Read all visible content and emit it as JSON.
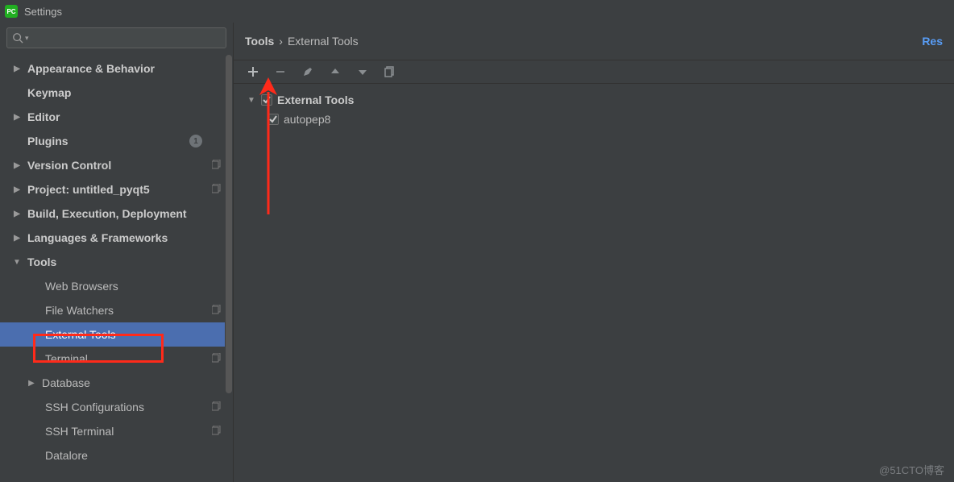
{
  "window": {
    "title": "Settings"
  },
  "search": {
    "placeholder": ""
  },
  "sidebar": {
    "items": [
      {
        "label": "Appearance & Behavior",
        "arrow": "▶",
        "bold": true,
        "indent": 0
      },
      {
        "label": "Keymap",
        "arrow": "",
        "bold": true,
        "indent": 0
      },
      {
        "label": "Editor",
        "arrow": "▶",
        "bold": true,
        "indent": 0
      },
      {
        "label": "Plugins",
        "arrow": "",
        "bold": true,
        "indent": 0,
        "badge": "1"
      },
      {
        "label": "Version Control",
        "arrow": "▶",
        "bold": true,
        "indent": 0,
        "copy": true
      },
      {
        "label": "Project: untitled_pyqt5",
        "arrow": "▶",
        "bold": true,
        "indent": 0,
        "copy": true
      },
      {
        "label": "Build, Execution, Deployment",
        "arrow": "▶",
        "bold": true,
        "indent": 0
      },
      {
        "label": "Languages & Frameworks",
        "arrow": "▶",
        "bold": true,
        "indent": 0
      },
      {
        "label": "Tools",
        "arrow": "▼",
        "bold": true,
        "indent": 0
      },
      {
        "label": "Web Browsers",
        "arrow": "",
        "bold": false,
        "indent": 1
      },
      {
        "label": "File Watchers",
        "arrow": "",
        "bold": false,
        "indent": 1,
        "copy": true
      },
      {
        "label": "External Tools",
        "arrow": "",
        "bold": false,
        "indent": 1,
        "selected": true
      },
      {
        "label": "Terminal",
        "arrow": "",
        "bold": false,
        "indent": 1,
        "copy": true
      },
      {
        "label": "Database",
        "arrow": "▶",
        "bold": false,
        "indent": 2
      },
      {
        "label": "SSH Configurations",
        "arrow": "",
        "bold": false,
        "indent": 1,
        "copy": true
      },
      {
        "label": "SSH Terminal",
        "arrow": "",
        "bold": false,
        "indent": 1,
        "copy": true
      },
      {
        "label": "Datalore",
        "arrow": "",
        "bold": false,
        "indent": 1
      }
    ]
  },
  "breadcrumb": {
    "root": "Tools",
    "sep": "›",
    "leaf": "External Tools",
    "reset": "Res"
  },
  "toolTree": {
    "group": "External Tools",
    "items": [
      {
        "label": "autopep8"
      }
    ]
  },
  "watermark": "@51CTO博客"
}
